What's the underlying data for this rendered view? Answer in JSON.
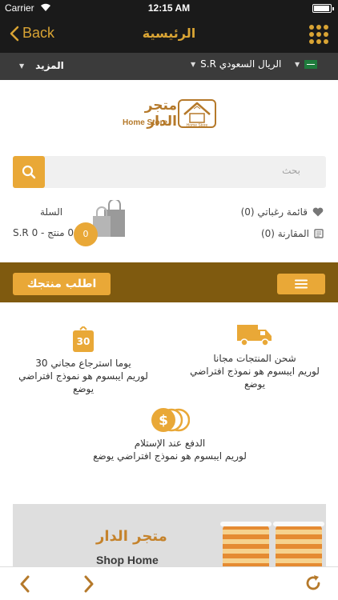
{
  "status_bar": {
    "carrier": "Carrier",
    "time": "12:15 AM"
  },
  "nav": {
    "back_label": "Back",
    "title": "الرئيسية"
  },
  "sub_bar": {
    "more_label": "المزيد",
    "currency_label": "S.R الريال السعودي"
  },
  "logo": {
    "name_ar": "متجر الدار",
    "name_en": "Home Store",
    "emblem_text": "Home Store"
  },
  "search": {
    "placeholder": "بحث"
  },
  "cart": {
    "label": "السلة",
    "count": "0",
    "summary": "0 منتج - S.R 0"
  },
  "links": {
    "wishlist": "قائمة رغباتي (0)",
    "compare": "المقارنة (0)"
  },
  "promo": {
    "request_label": "اطلب منتجك"
  },
  "features": {
    "shipping": {
      "title": "شحن المنتجات مجانا",
      "desc": "لوريم ايبسوم هو نموذج افتراضي يوضع"
    },
    "return": {
      "badge": "30",
      "title": "30 يوما استرجاع مجاني",
      "desc": "لوريم ايبسوم هو نموذج افتراضي يوضع"
    },
    "cod": {
      "title": "الدفع عند الإستلام",
      "desc": "لوريم ايبسوم هو نموذج افتراضي يوضع"
    }
  },
  "banner": {
    "title_ar": "متجر الدار",
    "title_en": "Shop Home"
  },
  "colors": {
    "accent": "#e9a837",
    "dark": "#1a1a1a",
    "band": "#7f5a0f",
    "brand": "#b5792a"
  }
}
